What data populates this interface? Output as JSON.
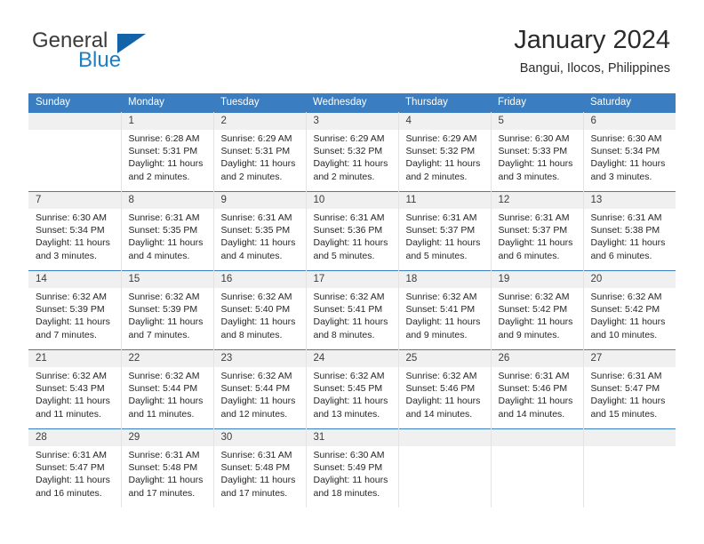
{
  "brand": {
    "name_part1": "General",
    "name_part2": "Blue",
    "logo_icon": "triangle-flag-icon",
    "accent_color": "#1263a8",
    "blue_text_color": "#1f7fc4"
  },
  "header": {
    "title": "January 2024",
    "subtitle": "Bangui, Ilocos, Philippines"
  },
  "calendar": {
    "header_bg": "#3a7dc0",
    "daynum_bg": "#f0f0f0",
    "weekday_headers": [
      "Sunday",
      "Monday",
      "Tuesday",
      "Wednesday",
      "Thursday",
      "Friday",
      "Saturday"
    ],
    "weeks": [
      [
        {
          "day": "",
          "sunrise": "",
          "sunset": "",
          "daylight": ""
        },
        {
          "day": "1",
          "sunrise": "Sunrise: 6:28 AM",
          "sunset": "Sunset: 5:31 PM",
          "daylight": "Daylight: 11 hours and 2 minutes."
        },
        {
          "day": "2",
          "sunrise": "Sunrise: 6:29 AM",
          "sunset": "Sunset: 5:31 PM",
          "daylight": "Daylight: 11 hours and 2 minutes."
        },
        {
          "day": "3",
          "sunrise": "Sunrise: 6:29 AM",
          "sunset": "Sunset: 5:32 PM",
          "daylight": "Daylight: 11 hours and 2 minutes."
        },
        {
          "day": "4",
          "sunrise": "Sunrise: 6:29 AM",
          "sunset": "Sunset: 5:32 PM",
          "daylight": "Daylight: 11 hours and 2 minutes."
        },
        {
          "day": "5",
          "sunrise": "Sunrise: 6:30 AM",
          "sunset": "Sunset: 5:33 PM",
          "daylight": "Daylight: 11 hours and 3 minutes."
        },
        {
          "day": "6",
          "sunrise": "Sunrise: 6:30 AM",
          "sunset": "Sunset: 5:34 PM",
          "daylight": "Daylight: 11 hours and 3 minutes."
        }
      ],
      [
        {
          "day": "7",
          "sunrise": "Sunrise: 6:30 AM",
          "sunset": "Sunset: 5:34 PM",
          "daylight": "Daylight: 11 hours and 3 minutes."
        },
        {
          "day": "8",
          "sunrise": "Sunrise: 6:31 AM",
          "sunset": "Sunset: 5:35 PM",
          "daylight": "Daylight: 11 hours and 4 minutes."
        },
        {
          "day": "9",
          "sunrise": "Sunrise: 6:31 AM",
          "sunset": "Sunset: 5:35 PM",
          "daylight": "Daylight: 11 hours and 4 minutes."
        },
        {
          "day": "10",
          "sunrise": "Sunrise: 6:31 AM",
          "sunset": "Sunset: 5:36 PM",
          "daylight": "Daylight: 11 hours and 5 minutes."
        },
        {
          "day": "11",
          "sunrise": "Sunrise: 6:31 AM",
          "sunset": "Sunset: 5:37 PM",
          "daylight": "Daylight: 11 hours and 5 minutes."
        },
        {
          "day": "12",
          "sunrise": "Sunrise: 6:31 AM",
          "sunset": "Sunset: 5:37 PM",
          "daylight": "Daylight: 11 hours and 6 minutes."
        },
        {
          "day": "13",
          "sunrise": "Sunrise: 6:31 AM",
          "sunset": "Sunset: 5:38 PM",
          "daylight": "Daylight: 11 hours and 6 minutes."
        }
      ],
      [
        {
          "day": "14",
          "sunrise": "Sunrise: 6:32 AM",
          "sunset": "Sunset: 5:39 PM",
          "daylight": "Daylight: 11 hours and 7 minutes."
        },
        {
          "day": "15",
          "sunrise": "Sunrise: 6:32 AM",
          "sunset": "Sunset: 5:39 PM",
          "daylight": "Daylight: 11 hours and 7 minutes."
        },
        {
          "day": "16",
          "sunrise": "Sunrise: 6:32 AM",
          "sunset": "Sunset: 5:40 PM",
          "daylight": "Daylight: 11 hours and 8 minutes."
        },
        {
          "day": "17",
          "sunrise": "Sunrise: 6:32 AM",
          "sunset": "Sunset: 5:41 PM",
          "daylight": "Daylight: 11 hours and 8 minutes."
        },
        {
          "day": "18",
          "sunrise": "Sunrise: 6:32 AM",
          "sunset": "Sunset: 5:41 PM",
          "daylight": "Daylight: 11 hours and 9 minutes."
        },
        {
          "day": "19",
          "sunrise": "Sunrise: 6:32 AM",
          "sunset": "Sunset: 5:42 PM",
          "daylight": "Daylight: 11 hours and 9 minutes."
        },
        {
          "day": "20",
          "sunrise": "Sunrise: 6:32 AM",
          "sunset": "Sunset: 5:42 PM",
          "daylight": "Daylight: 11 hours and 10 minutes."
        }
      ],
      [
        {
          "day": "21",
          "sunrise": "Sunrise: 6:32 AM",
          "sunset": "Sunset: 5:43 PM",
          "daylight": "Daylight: 11 hours and 11 minutes."
        },
        {
          "day": "22",
          "sunrise": "Sunrise: 6:32 AM",
          "sunset": "Sunset: 5:44 PM",
          "daylight": "Daylight: 11 hours and 11 minutes."
        },
        {
          "day": "23",
          "sunrise": "Sunrise: 6:32 AM",
          "sunset": "Sunset: 5:44 PM",
          "daylight": "Daylight: 11 hours and 12 minutes."
        },
        {
          "day": "24",
          "sunrise": "Sunrise: 6:32 AM",
          "sunset": "Sunset: 5:45 PM",
          "daylight": "Daylight: 11 hours and 13 minutes."
        },
        {
          "day": "25",
          "sunrise": "Sunrise: 6:32 AM",
          "sunset": "Sunset: 5:46 PM",
          "daylight": "Daylight: 11 hours and 14 minutes."
        },
        {
          "day": "26",
          "sunrise": "Sunrise: 6:31 AM",
          "sunset": "Sunset: 5:46 PM",
          "daylight": "Daylight: 11 hours and 14 minutes."
        },
        {
          "day": "27",
          "sunrise": "Sunrise: 6:31 AM",
          "sunset": "Sunset: 5:47 PM",
          "daylight": "Daylight: 11 hours and 15 minutes."
        }
      ],
      [
        {
          "day": "28",
          "sunrise": "Sunrise: 6:31 AM",
          "sunset": "Sunset: 5:47 PM",
          "daylight": "Daylight: 11 hours and 16 minutes."
        },
        {
          "day": "29",
          "sunrise": "Sunrise: 6:31 AM",
          "sunset": "Sunset: 5:48 PM",
          "daylight": "Daylight: 11 hours and 17 minutes."
        },
        {
          "day": "30",
          "sunrise": "Sunrise: 6:31 AM",
          "sunset": "Sunset: 5:48 PM",
          "daylight": "Daylight: 11 hours and 17 minutes."
        },
        {
          "day": "31",
          "sunrise": "Sunrise: 6:30 AM",
          "sunset": "Sunset: 5:49 PM",
          "daylight": "Daylight: 11 hours and 18 minutes."
        },
        {
          "day": "",
          "sunrise": "",
          "sunset": "",
          "daylight": ""
        },
        {
          "day": "",
          "sunrise": "",
          "sunset": "",
          "daylight": ""
        },
        {
          "day": "",
          "sunrise": "",
          "sunset": "",
          "daylight": ""
        }
      ]
    ]
  }
}
